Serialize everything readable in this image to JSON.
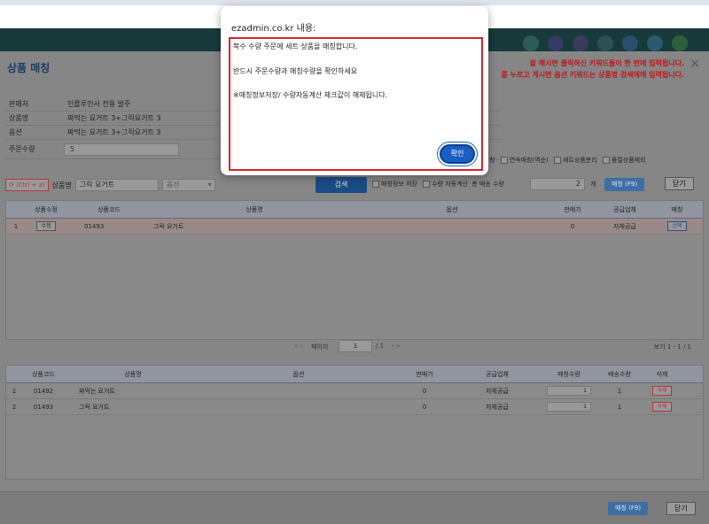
{
  "page": {
    "title": "상품 매칭",
    "close_label": "×",
    "notice_lines": [
      "을 해시면 클릭하신 키워드들이 한 번에 입력됩니다.",
      "를 누르고 게시면 옵션 키워드는 상품명 검색에에 입력됩니다."
    ]
  },
  "info": {
    "rows": [
      {
        "label": "판매처",
        "value": "인플루언서 전용 발주"
      },
      {
        "label": "상품명",
        "value": "짜먹는 요거트 3+그릭요거트 3"
      },
      {
        "label": "옵션",
        "value": "짜먹는 요거트 3+그릭요거트 3"
      },
      {
        "label": "주문수량",
        "value": "5"
      }
    ]
  },
  "options": {
    "items": [
      "칭",
      "연속매칭(역순)",
      "세트상품분리",
      "품절상품제외"
    ]
  },
  "search": {
    "ctrl_label": "(Ctrl + a)",
    "product_label": "상품명",
    "product_value": "그릭 요거트",
    "option_placeholder": "옵션",
    "search_button": "검색",
    "save_check": "매칭정보 저장",
    "auto_qty_check": "수량 자동계산",
    "total_qty_label": "총 배송 수량",
    "total_qty_value": "2",
    "unit": "개",
    "match_button": "매칭 (F9)",
    "close_button": "닫기"
  },
  "top_grid": {
    "headers": [
      "상품수정",
      "상품코드",
      "상품명",
      "옵션",
      "판매가",
      "공급업체",
      "매칭"
    ],
    "rows": [
      {
        "no": "1",
        "edit": "수정",
        "code": "01493",
        "name": "그릭 요거트",
        "option": "",
        "price": "0",
        "supplier": "자체공급",
        "action": "선택"
      }
    ]
  },
  "pager": {
    "nav_prev": "« ‹",
    "page_label": "페이지",
    "page_value": "1",
    "page_total": "/ 1",
    "nav_next": "› »",
    "view_info": "보기 1 - 1 / 1"
  },
  "bottom_grid": {
    "headers": [
      "상품코드",
      "상품명",
      "옵션",
      "판매가",
      "공급업체",
      "매칭수량",
      "배송수량",
      "삭제"
    ],
    "rows": [
      {
        "no": "1",
        "code": "01492",
        "name": "짜먹는 요거트",
        "option": "",
        "price": "0",
        "supplier": "자체공급",
        "match_qty": "1",
        "ship_qty": "1",
        "delete": "삭제"
      },
      {
        "no": "2",
        "code": "01493",
        "name": "그릭 요거트",
        "option": "",
        "price": "0",
        "supplier": "자체공급",
        "match_qty": "1",
        "ship_qty": "1",
        "delete": "삭제"
      }
    ]
  },
  "footer": {
    "match_button": "매칭 (F9)",
    "close_button": "닫기"
  },
  "dialog": {
    "title": "ezadmin.co.kr 내용:",
    "lines": [
      "복수 수량 주문에 세트 상품을 매칭합니다.",
      "반드시 주문수량과 매칭수량을 확인하세요",
      "※매칭정보저장/ 수량자동계산 체크값이 해제됩니다."
    ],
    "ok_button": "확인"
  },
  "colors": {
    "dialog_border": "#d8232a",
    "ok_button": "#1a5ec4",
    "notice": "#c0161c"
  }
}
